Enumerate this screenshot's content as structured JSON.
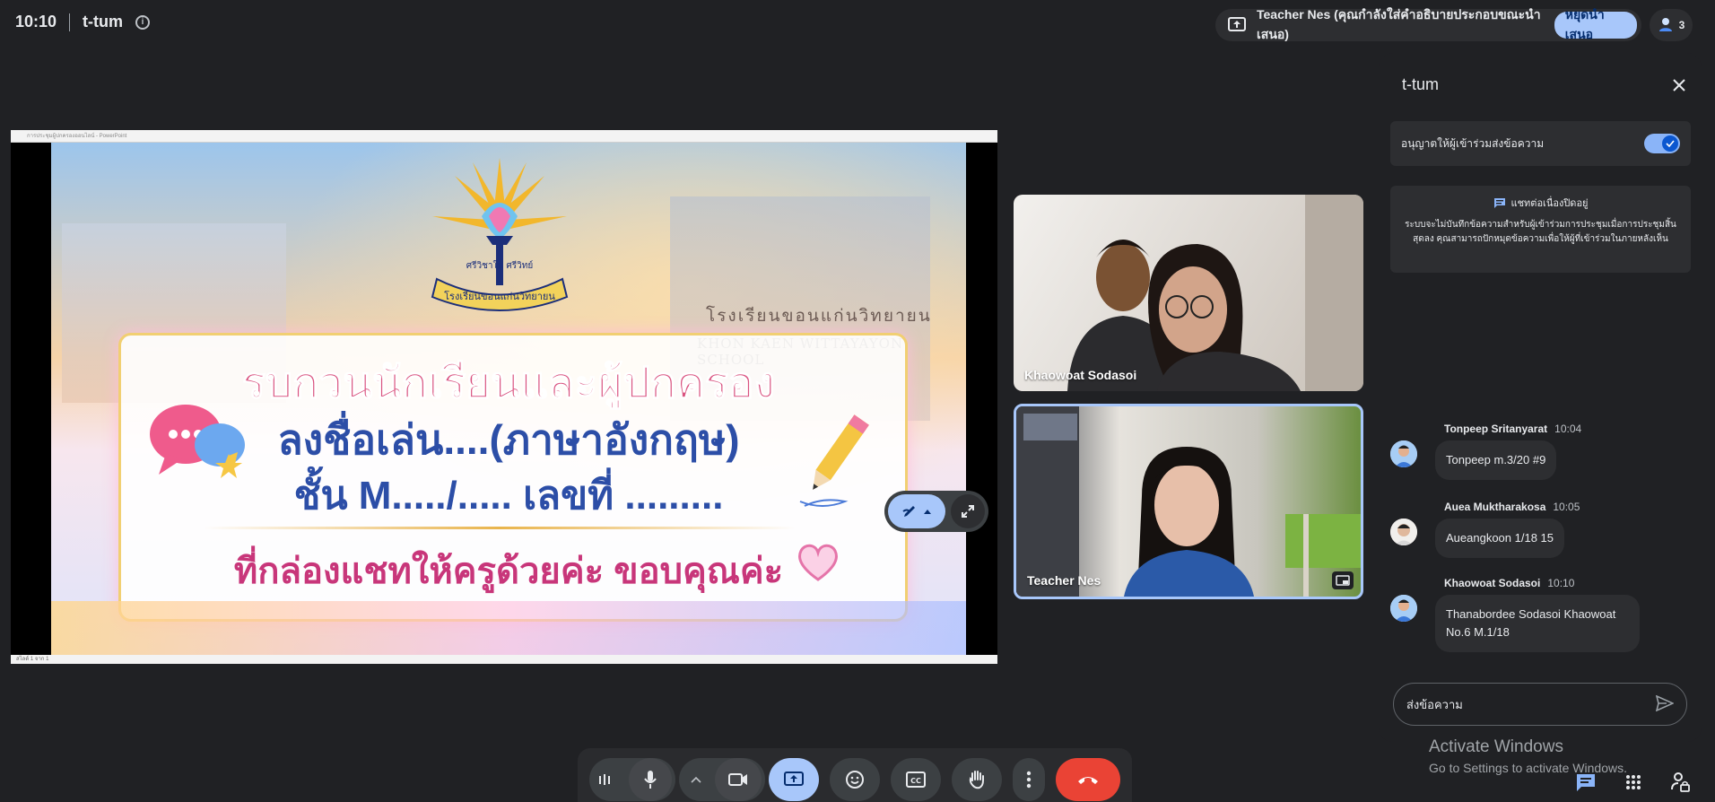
{
  "top_bar": {
    "time": "10:10",
    "meeting_name": "t-tum",
    "presenter_text": "Teacher Nes (คุณกำลังใส่คำอธิบายประกอบขณะนำเสนอ)",
    "stop_presenting_label": "หยุดนำเสนอ",
    "participant_count": "3"
  },
  "presentation": {
    "window_title": "การประชุมผู้ปกครองออนไลน์ - PowerPoint",
    "status_text": "สไลด์ 1 จาก 1",
    "slide": {
      "line1": "รบกวนนักเรียนและผู้ปกครอง",
      "line2": "ลงชื่อเล่น....(ภาษาอังกฤษ)",
      "line3": "ชั้น M...../..... เลขที่ .........",
      "line4": "ที่กล่องแชทให้ครูด้วยค่ะ ขอบคุณค่ะ",
      "school_sign_th": "โรงเรียนขอนแก่นวิทยายน",
      "school_sign_en": "KHON KAEN WITTAYAYON SCHOOL",
      "emblem_motto": "ศรีวิชาใน ศรีวิทย์",
      "emblem_school": "โรงเรียนขอนแก่นวิทยายน"
    }
  },
  "tiles": [
    {
      "name": "Khaowoat Sodasoi"
    },
    {
      "name": "Teacher Nes"
    }
  ],
  "chat": {
    "title": "t-tum",
    "allow_label": "อนุญาตให้ผู้เข้าร่วมส่งข้อความ",
    "allow_enabled": true,
    "notice_title": "แชทต่อเนื่องปิดอยู่",
    "notice_body": "ระบบจะไม่บันทึกข้อความสำหรับผู้เข้าร่วมการประชุมเมื่อการประชุมสิ้นสุดลง คุณสามารถปักหมุดข้อความเพื่อให้ผู้ที่เข้าร่วมในภายหลังเห็น",
    "messages": [
      {
        "sender": "Tonpeep Sritanyarat",
        "time": "10:04",
        "text": "Tonpeep m.3/20 #9"
      },
      {
        "sender": "Auea Muktharakosa",
        "time": "10:05",
        "text": "Aueangkoon 1/18 15"
      },
      {
        "sender": "Khaowoat Sodasoi",
        "time": "10:10",
        "text": "Thanabordee Sodasoi Khaowoat No.6 M.1/18"
      }
    ],
    "input_placeholder": "ส่งข้อความ"
  },
  "windows_watermark": {
    "line1": "Activate Windows",
    "line2": "Go to Settings to activate Windows."
  },
  "colors": {
    "background": "#202124",
    "accent": "#a8c7fa",
    "hangup": "#ea4335"
  }
}
